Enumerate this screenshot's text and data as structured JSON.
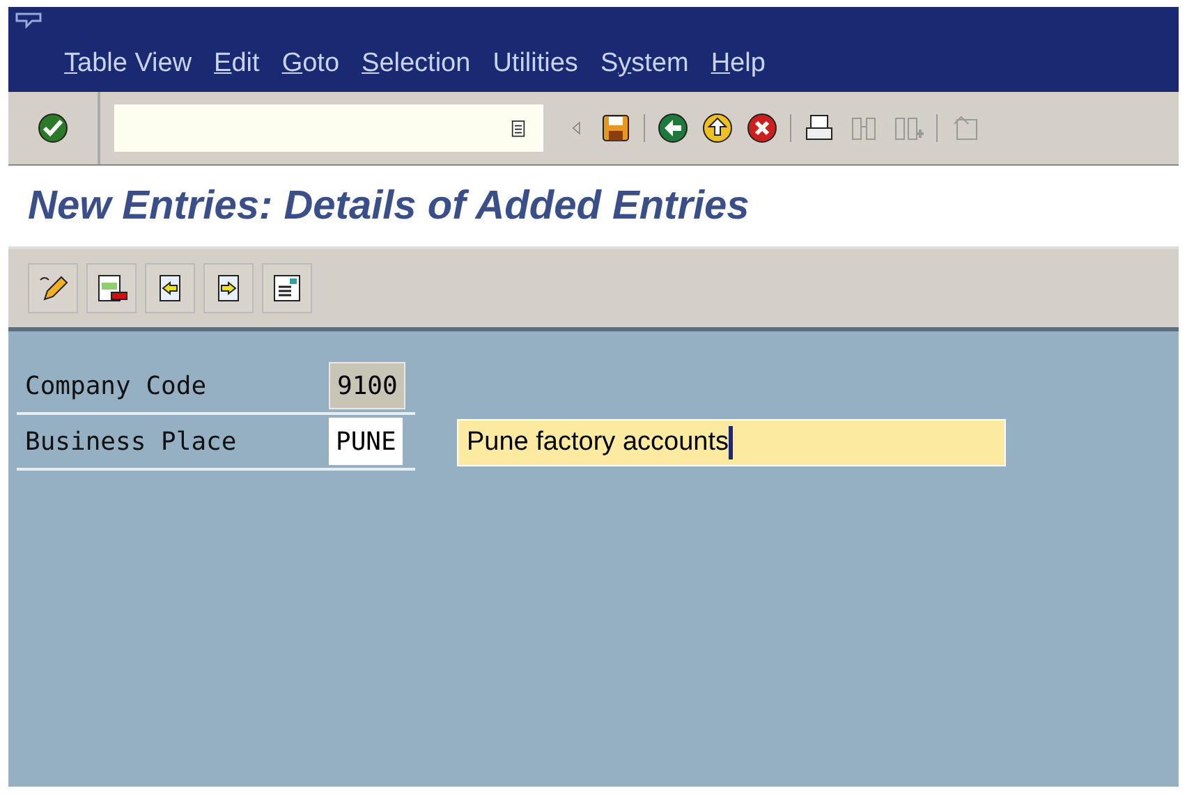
{
  "menu": [
    {
      "underlined": "T",
      "rest": "able View"
    },
    {
      "underlined": "E",
      "rest": "dit"
    },
    {
      "underlined": "G",
      "rest": "oto"
    },
    {
      "underlined": "S",
      "rest": "election"
    },
    {
      "rest": "Utilities"
    },
    {
      "before": "S",
      "underlined": "y",
      "rest": "stem"
    },
    {
      "underlined": "H",
      "rest": "elp"
    }
  ],
  "screen_title": "New Entries: Details of Added Entries",
  "fields": [
    {
      "label": "Company Code",
      "value": "9100",
      "disabled": true
    },
    {
      "label": "Business Place",
      "value": "PUNE",
      "disabled": false,
      "description": "Pune factory accounts"
    }
  ]
}
